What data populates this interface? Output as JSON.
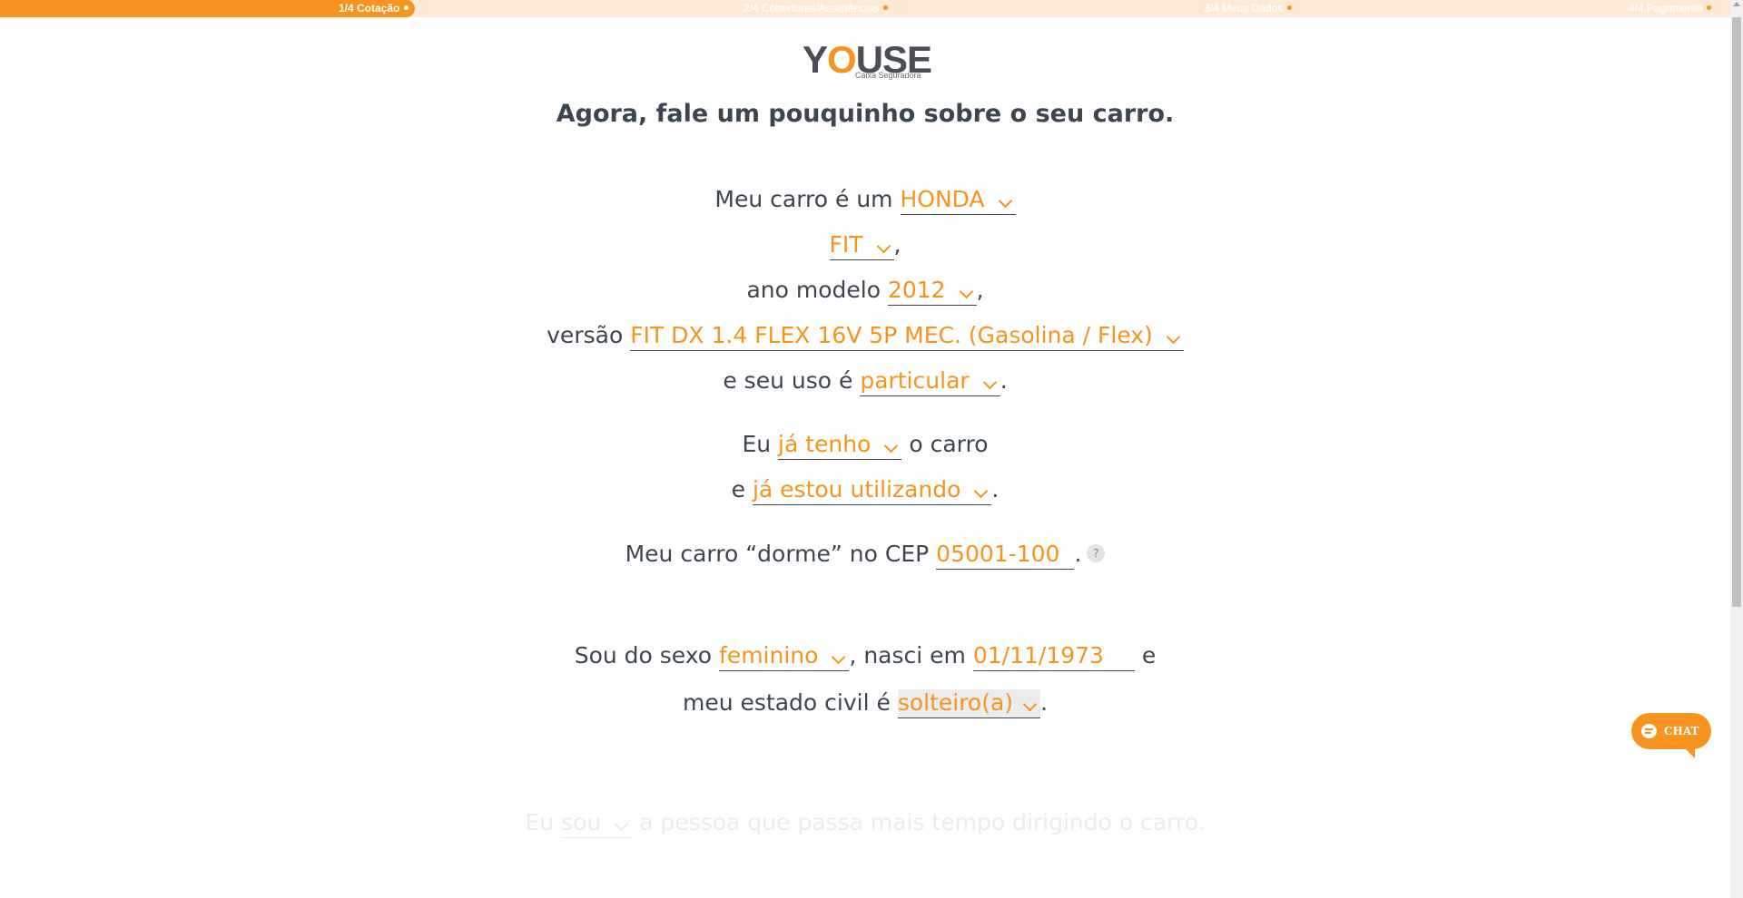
{
  "progress": {
    "steps": [
      {
        "label": "1/4 Cotação",
        "active": true
      },
      {
        "label": "2/4 Coberturas/Assistências",
        "active": false
      },
      {
        "label": "3/4 Meus Dados",
        "active": false
      },
      {
        "label": "4/4 Pagamento",
        "active": false
      }
    ]
  },
  "logo": {
    "wordmark_y": "Y",
    "wordmark_o": "O",
    "wordmark_rest": "USE",
    "tagline": "Caixa Seguradora"
  },
  "title": "Agora, fale um pouquinho sobre o seu carro.",
  "form": {
    "brand_prefix": "Meu carro é um",
    "brand": "HONDA",
    "model": "FIT",
    "model_suffix": ",",
    "year_prefix": "ano modelo",
    "year": "2012",
    "year_suffix": ",",
    "version_prefix": "versão",
    "version": "FIT DX 1.4 FLEX 16V 5P MEC. (Gasolina / Flex)",
    "use_prefix": "e seu uso é",
    "use": "particular",
    "use_suffix": ".",
    "own_prefix": "Eu",
    "own": "já tenho",
    "own_suffix": "o carro",
    "using_prefix": "e",
    "using": "já estou utilizando",
    "using_suffix": ".",
    "cep_prefix": "Meu carro “dorme” no CEP",
    "cep": "05001-100",
    "cep_suffix": ".",
    "cep_help": "?",
    "sex_prefix": "Sou do sexo",
    "sex": "feminino",
    "birth_prefix": ", nasci em",
    "birth": "01/11/1973",
    "birth_suffix": "e",
    "civil_prefix": "meu estado civil é",
    "civil": "solteiro(a)",
    "civil_suffix": ".",
    "driver_prefix": "Eu",
    "driver": "sou",
    "driver_suffix": "a pessoa que passa mais tempo dirigindo o carro."
  },
  "chat": {
    "label": "CHAT"
  },
  "colors": {
    "accent": "#f7931e",
    "text": "#3d4650",
    "progress_bg": "#fde9d6"
  }
}
